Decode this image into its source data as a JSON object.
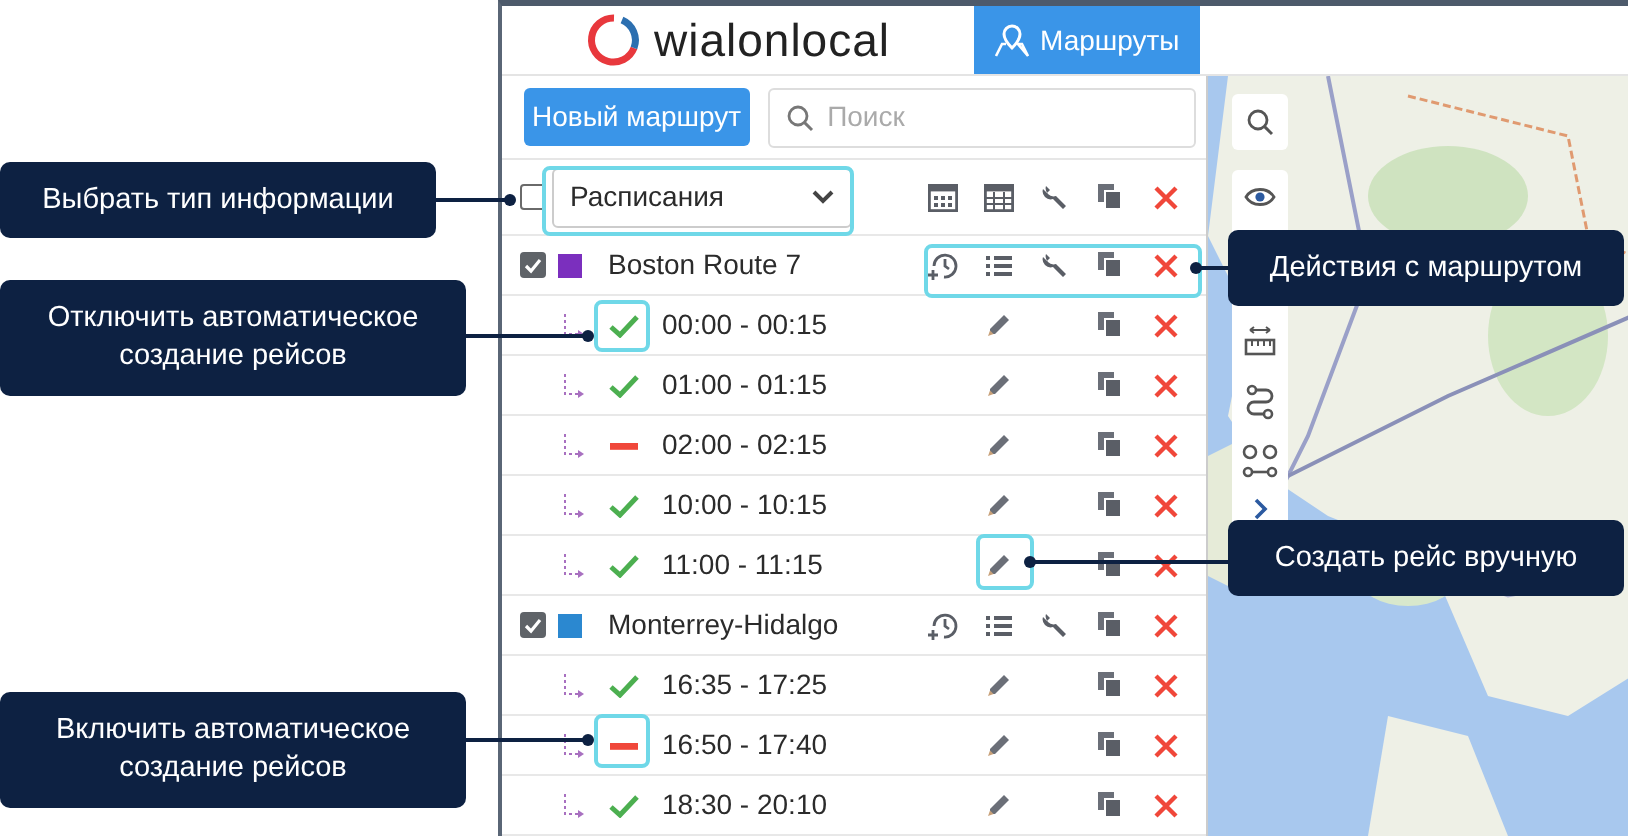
{
  "header": {
    "logo": "wialonlocal",
    "tabs": [
      {
        "label": "Маршруты",
        "selected": true
      }
    ]
  },
  "toolbar": {
    "new_button": "Новый маршрут",
    "search": {
      "placeholder": "Поиск"
    }
  },
  "filter": {
    "checked": false,
    "value": "Расписания"
  },
  "routes": [
    {
      "name": "Boston Route 7",
      "checked": true,
      "color": "#7b2fbe",
      "schedules": [
        {
          "time": "00:00 - 00:15",
          "auto": true
        },
        {
          "time": "01:00 - 01:15",
          "auto": true
        },
        {
          "time": "02:00 - 02:15",
          "auto": false
        },
        {
          "time": "10:00 - 10:15",
          "auto": true
        },
        {
          "time": "11:00 - 11:15",
          "auto": true
        }
      ]
    },
    {
      "name": "Monterrey-Hidalgo",
      "checked": true,
      "color": "#2b88d0",
      "schedules": [
        {
          "time": "16:35 - 17:25",
          "auto": true
        },
        {
          "time": "16:50 - 17:40",
          "auto": false
        },
        {
          "time": "18:30 - 20:10",
          "auto": true
        }
      ]
    }
  ],
  "callouts": [
    {
      "text": "Выбрать тип информации"
    },
    {
      "text": "Отключить автоматическое создание рейсов"
    },
    {
      "text": "Действия с маршрутом"
    },
    {
      "text": "Создать рейс вручную"
    },
    {
      "text": "Включить автоматическое создание рейсов"
    }
  ]
}
